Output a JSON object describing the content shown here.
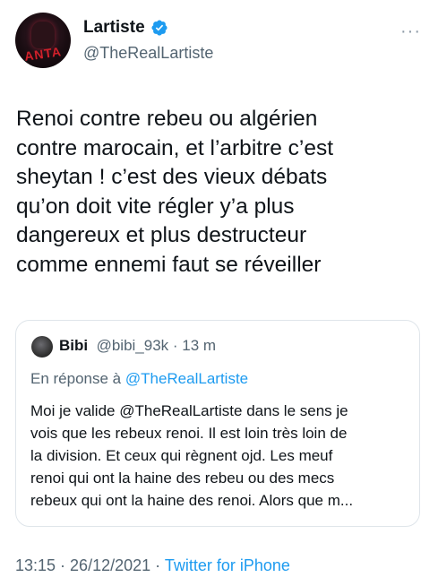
{
  "tweet": {
    "author_name": "Lartiste",
    "author_handle": "@TheRealLartiste",
    "avatar_text": "ANTA",
    "text": "Renoi contre rebeu ou algérien\ncontre marocain, et l’arbitre c’est\nsheytan ! c’est des vieux débats\nqu’on doit vite régler y’a plus\ndangereux et plus destructeur\ncomme ennemi faut se réveiller",
    "more_label": "···",
    "time": "13:15",
    "date": "26/12/2021",
    "source": "Twitter for iPhone",
    "separator": " · "
  },
  "quote": {
    "author_name": "Bibi",
    "author_handle": "@bibi_93k",
    "age": "13 m",
    "reply_prefix": "En réponse à ",
    "reply_to": "@TheRealLartiste",
    "text_before_mention": "Moi je valide ",
    "mention": "@TheRealLartiste",
    "text_after_mention": " dans le sens je\nvois que les rebeux renoi. Il est loin très loin de\nla division. Et ceux qui règnent ojd. Les meuf\nrenoi qui ont la haine des rebeu ou des mecs\nrebeux qui ont la haine des renoi. Alors que m..."
  },
  "colors": {
    "primary_text": "#0f1419",
    "secondary_text": "#536471",
    "accent": "#1d9bf0"
  }
}
